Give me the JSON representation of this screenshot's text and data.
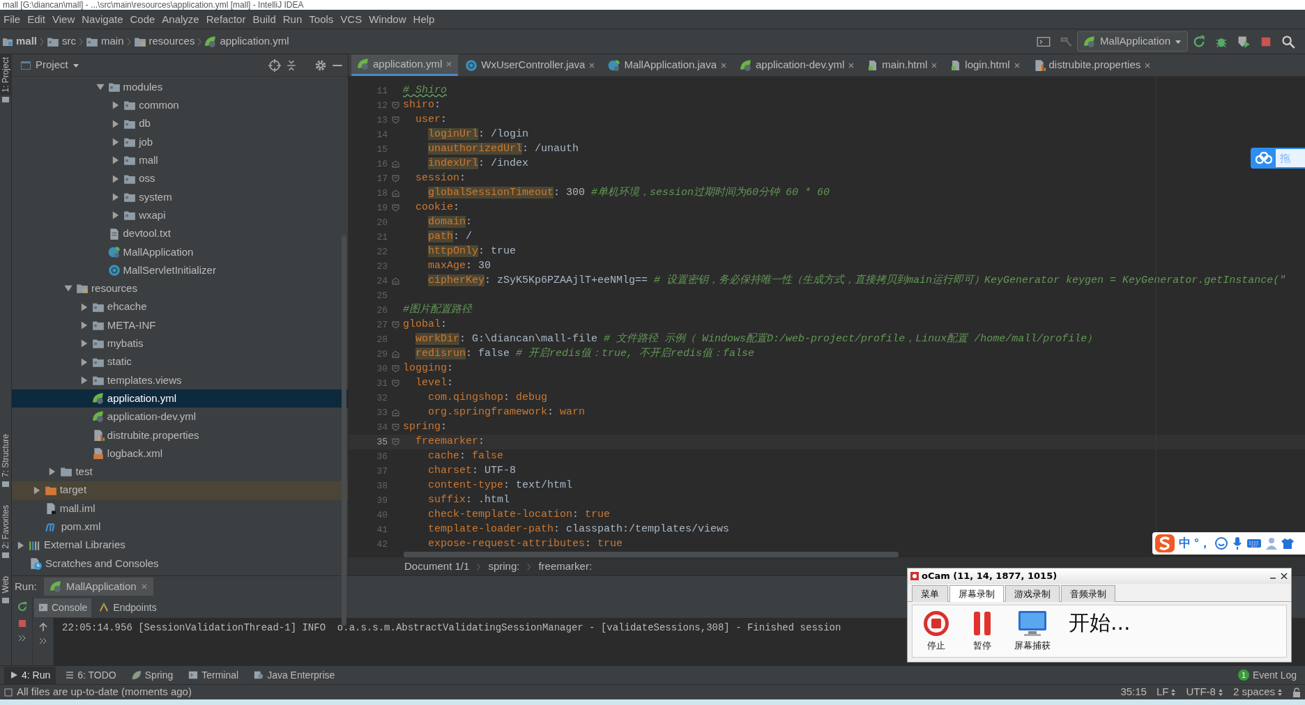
{
  "title_bar": {
    "title": "mall [G:\\diancan\\mall] - ...\\src\\main\\resources\\application.yml [mall] - IntelliJ IDEA"
  },
  "menu": [
    "File",
    "Edit",
    "View",
    "Navigate",
    "Code",
    "Analyze",
    "Refactor",
    "Build",
    "Run",
    "Tools",
    "VCS",
    "Window",
    "Help"
  ],
  "breadcrumbs": [
    {
      "label": "mall",
      "kind": "module"
    },
    {
      "label": "src",
      "kind": "folder"
    },
    {
      "label": "main",
      "kind": "folder"
    },
    {
      "label": "resources",
      "kind": "resources-folder"
    },
    {
      "label": "application.yml",
      "kind": "yaml"
    }
  ],
  "run_config": {
    "label": "MallApplication"
  },
  "side_tabs": [
    {
      "label": "1: Project",
      "selected": true
    },
    {
      "label": "7: Structure",
      "selected": false
    },
    {
      "label": "2: Favorites",
      "selected": false
    },
    {
      "label": "Web",
      "selected": false
    }
  ],
  "project_panel": {
    "title": "Project",
    "tree": [
      {
        "children": [
          {
            "children": [
              {
                "children": [
                  {
                    "children": [
                      {
                        "children": [
                          {
                            "label": "modules",
                            "kind": "folder",
                            "expanded": true,
                            "selected": false,
                            "children": [
                              {
                                "label": "common",
                                "kind": "folder",
                                "expanded": false,
                                "selected": false
                              },
                              {
                                "label": "db",
                                "kind": "folder",
                                "expanded": false,
                                "selected": false
                              },
                              {
                                "label": "job",
                                "kind": "folder",
                                "expanded": false,
                                "selected": false
                              },
                              {
                                "label": "mall",
                                "kind": "folder",
                                "expanded": false,
                                "selected": false
                              },
                              {
                                "label": "oss",
                                "kind": "folder",
                                "expanded": false,
                                "selected": false
                              },
                              {
                                "label": "system",
                                "kind": "folder",
                                "expanded": false,
                                "selected": false
                              },
                              {
                                "label": "wxapi",
                                "kind": "folder",
                                "expanded": false,
                                "selected": false
                              }
                            ]
                          },
                          {
                            "label": "devtool.txt",
                            "kind": "text",
                            "selected": false
                          },
                          {
                            "label": "MallApplication",
                            "kind": "spring-class",
                            "selected": false
                          },
                          {
                            "label": "MallServletInitializer",
                            "kind": "class",
                            "selected": false
                          }
                        ]
                      }
                    ]
                  },
                  {
                    "label": "resources",
                    "kind": "resources-folder",
                    "expanded": true,
                    "selected": false,
                    "children": [
                      {
                        "label": "ehcache",
                        "kind": "folder",
                        "expanded": false,
                        "selected": false
                      },
                      {
                        "label": "META-INF",
                        "kind": "folder",
                        "expanded": false,
                        "selected": false
                      },
                      {
                        "label": "mybatis",
                        "kind": "folder",
                        "expanded": false,
                        "selected": false
                      },
                      {
                        "label": "static",
                        "kind": "folder",
                        "expanded": false,
                        "selected": false
                      },
                      {
                        "label": "templates.views",
                        "kind": "folder",
                        "expanded": false,
                        "selected": false
                      },
                      {
                        "label": "application.yml",
                        "kind": "yaml",
                        "selected": true
                      },
                      {
                        "label": "application-dev.yml",
                        "kind": "yaml",
                        "selected": false
                      },
                      {
                        "label": "distrubite.properties",
                        "kind": "properties",
                        "selected": false
                      },
                      {
                        "label": "logback.xml",
                        "kind": "xml",
                        "selected": false
                      }
                    ]
                  }
                ]
              },
              {
                "label": "test",
                "kind": "plain-folder",
                "expanded": false,
                "selected": false
              }
            ]
          },
          {
            "label": "target",
            "kind": "excluded-folder",
            "expanded": false,
            "selected": false
          },
          {
            "label": "mall.iml",
            "kind": "iml",
            "selected": false
          },
          {
            "label": "pom.xml",
            "kind": "maven",
            "selected": false
          }
        ]
      },
      {
        "label": "External Libraries",
        "kind": "libraries",
        "expanded": false,
        "selected": false
      },
      {
        "label": "Scratches and Consoles",
        "kind": "scratches",
        "selected": false
      }
    ]
  },
  "editor_tabs": [
    {
      "label": "application.yml",
      "kind": "yaml",
      "selected": true
    },
    {
      "label": "WxUserController.java",
      "kind": "class",
      "selected": false
    },
    {
      "label": "MallApplication.java",
      "kind": "spring-class",
      "selected": false
    },
    {
      "label": "application-dev.yml",
      "kind": "yaml",
      "selected": false
    },
    {
      "label": "main.html",
      "kind": "html",
      "selected": false
    },
    {
      "label": "login.html",
      "kind": "html",
      "selected": false
    },
    {
      "label": "distrubite.properties",
      "kind": "properties",
      "selected": false
    }
  ],
  "code_lines": [
    {
      "number": "11",
      "fold_start": false,
      "fold_end": false,
      "current": false,
      "segments": [
        {
          "kind": "comment-typo",
          "text": "# Shiro"
        }
      ]
    },
    {
      "number": "12",
      "fold_start": true,
      "fold_end": false,
      "current": false,
      "segments": [
        {
          "kind": "key",
          "text": "shiro"
        },
        {
          "kind": "text",
          "text": ":"
        }
      ]
    },
    {
      "number": "13",
      "fold_start": true,
      "fold_end": false,
      "current": false,
      "segments": [
        {
          "kind": "key",
          "text": "  user"
        },
        {
          "kind": "text",
          "text": ":"
        }
      ]
    },
    {
      "number": "14",
      "fold_start": false,
      "fold_end": false,
      "current": false,
      "segments": [
        {
          "kind": "key-hl",
          "text": "    loginUrl"
        },
        {
          "kind": "text",
          "text": ": /login"
        }
      ]
    },
    {
      "number": "15",
      "fold_start": false,
      "fold_end": false,
      "current": false,
      "segments": [
        {
          "kind": "key-hl",
          "text": "    unauthorizedUrl"
        },
        {
          "kind": "text",
          "text": ": /unauth"
        }
      ]
    },
    {
      "number": "16",
      "fold_start": false,
      "fold_end": true,
      "current": false,
      "segments": [
        {
          "kind": "key-hl",
          "text": "    indexUrl"
        },
        {
          "kind": "text",
          "text": ": /index"
        }
      ]
    },
    {
      "number": "17",
      "fold_start": true,
      "fold_end": false,
      "current": false,
      "segments": [
        {
          "kind": "key",
          "text": "  session"
        },
        {
          "kind": "text",
          "text": ":"
        }
      ]
    },
    {
      "number": "18",
      "fold_start": false,
      "fold_end": true,
      "current": false,
      "segments": [
        {
          "kind": "key-hl",
          "text": "    globalSessionTimeout"
        },
        {
          "kind": "text",
          "text": ": 300 "
        },
        {
          "kind": "comment",
          "text": "#单机环境，session过期时间为60分钟 60 * 60"
        }
      ]
    },
    {
      "number": "19",
      "fold_start": true,
      "fold_end": false,
      "current": false,
      "segments": [
        {
          "kind": "key",
          "text": "  cookie"
        },
        {
          "kind": "text",
          "text": ":"
        }
      ]
    },
    {
      "number": "20",
      "fold_start": false,
      "fold_end": false,
      "current": false,
      "segments": [
        {
          "kind": "key-hl",
          "text": "    domain"
        },
        {
          "kind": "text",
          "text": ":"
        }
      ]
    },
    {
      "number": "21",
      "fold_start": false,
      "fold_end": false,
      "current": false,
      "segments": [
        {
          "kind": "key-hl",
          "text": "    path"
        },
        {
          "kind": "text",
          "text": ": /"
        }
      ]
    },
    {
      "number": "22",
      "fold_start": false,
      "fold_end": false,
      "current": false,
      "segments": [
        {
          "kind": "key-hl",
          "text": "    httpOnly"
        },
        {
          "kind": "text",
          "text": ": true"
        }
      ]
    },
    {
      "number": "23",
      "fold_start": false,
      "fold_end": false,
      "current": false,
      "segments": [
        {
          "kind": "key",
          "text": "    maxAge"
        },
        {
          "kind": "text",
          "text": ": 30"
        }
      ]
    },
    {
      "number": "24",
      "fold_start": false,
      "fold_end": true,
      "current": false,
      "segments": [
        {
          "kind": "key-hl",
          "text": "    cipherKey"
        },
        {
          "kind": "text",
          "text": ": zSyK5Kp6PZAAjlT+eeNMlg== "
        },
        {
          "kind": "comment",
          "text": "# 设置密钥，务必保持唯一性（生成方式，直接拷贝到main运行即可）KeyGenerator keygen = KeyGenerator.getInstance(\""
        }
      ]
    },
    {
      "number": "25",
      "fold_start": false,
      "fold_end": false,
      "current": false
    },
    {
      "number": "26",
      "fold_start": false,
      "fold_end": false,
      "current": false,
      "segments": [
        {
          "kind": "comment",
          "text": "#图片配置路径"
        }
      ]
    },
    {
      "number": "27",
      "fold_start": true,
      "fold_end": false,
      "current": false,
      "segments": [
        {
          "kind": "key",
          "text": "global"
        },
        {
          "kind": "text",
          "text": ":"
        }
      ]
    },
    {
      "number": "28",
      "fold_start": false,
      "fold_end": false,
      "current": false,
      "segments": [
        {
          "kind": "key-hl",
          "text": "  workDir"
        },
        {
          "kind": "text",
          "text": ": G:\\diancan\\mall-file "
        },
        {
          "kind": "comment",
          "text": "# 文件路径 示例（ Windows配置D:/web-project/profile，Linux配置 /home/mall/profile）"
        }
      ]
    },
    {
      "number": "29",
      "fold_start": false,
      "fold_end": true,
      "current": false,
      "segments": [
        {
          "kind": "key-hl",
          "text": "  redisrun"
        },
        {
          "kind": "text",
          "text": ": false "
        },
        {
          "kind": "comment",
          "text": "# 开启redis值：true, 不开启redis值：false"
        }
      ]
    },
    {
      "number": "30",
      "fold_start": true,
      "fold_end": false,
      "current": false,
      "segments": [
        {
          "kind": "key",
          "text": "logging"
        },
        {
          "kind": "text",
          "text": ":"
        }
      ]
    },
    {
      "number": "31",
      "fold_start": true,
      "fold_end": false,
      "current": false,
      "segments": [
        {
          "kind": "key",
          "text": "  level"
        },
        {
          "kind": "text",
          "text": ":"
        }
      ]
    },
    {
      "number": "32",
      "fold_start": false,
      "fold_end": false,
      "current": false,
      "segments": [
        {
          "kind": "key",
          "text": "    com.qingshop"
        },
        {
          "kind": "text",
          "text": ": "
        },
        {
          "kind": "keyword",
          "text": "debug"
        }
      ]
    },
    {
      "number": "33",
      "fold_start": false,
      "fold_end": true,
      "current": false,
      "segments": [
        {
          "kind": "key",
          "text": "    org.springframework"
        },
        {
          "kind": "text",
          "text": ": "
        },
        {
          "kind": "keyword",
          "text": "warn"
        }
      ]
    },
    {
      "number": "34",
      "fold_start": true,
      "fold_end": false,
      "current": false,
      "segments": [
        {
          "kind": "key",
          "text": "spring"
        },
        {
          "kind": "text",
          "text": ":"
        }
      ]
    },
    {
      "number": "35",
      "fold_start": true,
      "fold_end": false,
      "current": true,
      "segments": [
        {
          "kind": "key",
          "text": "  freemarker"
        },
        {
          "kind": "text",
          "text": ":"
        }
      ]
    },
    {
      "number": "36",
      "fold_start": false,
      "fold_end": false,
      "current": false,
      "segments": [
        {
          "kind": "key",
          "text": "    cache"
        },
        {
          "kind": "text",
          "text": ": "
        },
        {
          "kind": "keyword",
          "text": "false"
        }
      ]
    },
    {
      "number": "37",
      "fold_start": false,
      "fold_end": false,
      "current": false,
      "segments": [
        {
          "kind": "key",
          "text": "    charset"
        },
        {
          "kind": "text",
          "text": ": UTF-8"
        }
      ]
    },
    {
      "number": "38",
      "fold_start": false,
      "fold_end": false,
      "current": false,
      "segments": [
        {
          "kind": "key",
          "text": "    content-type"
        },
        {
          "kind": "text",
          "text": ": text/html"
        }
      ]
    },
    {
      "number": "39",
      "fold_start": false,
      "fold_end": false,
      "current": false,
      "segments": [
        {
          "kind": "key",
          "text": "    suffix"
        },
        {
          "kind": "text",
          "text": ": .html"
        }
      ]
    },
    {
      "number": "40",
      "fold_start": false,
      "fold_end": false,
      "current": false,
      "segments": [
        {
          "kind": "key",
          "text": "    check-template-location"
        },
        {
          "kind": "text",
          "text": ": "
        },
        {
          "kind": "keyword",
          "text": "true"
        }
      ]
    },
    {
      "number": "41",
      "fold_start": false,
      "fold_end": false,
      "current": false,
      "segments": [
        {
          "kind": "key",
          "text": "    template-loader-path"
        },
        {
          "kind": "text",
          "text": ": classpath:/templates/views"
        }
      ]
    },
    {
      "number": "42",
      "fold_start": false,
      "fold_end": false,
      "current": false,
      "segments": [
        {
          "kind": "key",
          "text": "    expose-request-attributes"
        },
        {
          "kind": "text",
          "text": ": "
        },
        {
          "kind": "keyword",
          "text": "true"
        }
      ]
    }
  ],
  "editor_breadcrumbs": [
    "Document 1/1",
    "spring:",
    "freemarker:"
  ],
  "run_panel": {
    "label": "Run:",
    "config": "MallApplication",
    "tabs": [
      {
        "label": "Console",
        "kind": "console",
        "selected": true
      },
      {
        "label": "Endpoints",
        "kind": "endpoints",
        "selected": false
      }
    ],
    "log_lines": [
      "22:05:14.956 [SessionValidationThread-1] INFO  o.a.s.s.m.AbstractValidatingSessionManager - [validateSessions,308] - Finished session"
    ]
  },
  "tool_tabs": [
    {
      "label": "4: Run",
      "kind": "run",
      "selected": true
    },
    {
      "label": "6: TODO",
      "kind": "todo",
      "selected": false
    },
    {
      "label": "Spring",
      "kind": "spring",
      "selected": false
    },
    {
      "label": "Terminal",
      "kind": "terminal",
      "selected": false
    },
    {
      "label": "Java Enterprise",
      "kind": "java-ee",
      "selected": false
    }
  ],
  "event_log": {
    "label": "Event Log",
    "count": "1"
  },
  "status_bar": {
    "message": "All files are up-to-date (moments ago)",
    "position": "35:15",
    "line_separator": "LF",
    "encoding": "UTF-8",
    "indent": "2 spaces"
  },
  "cloud_widget": {
    "label": "拖"
  },
  "ime_toolbar": {
    "items": [
      "中",
      "°，"
    ]
  },
  "ocam": {
    "title": "oCam (11, 14, 1877, 1015)",
    "tabs": [
      {
        "label": "菜单",
        "selected": false
      },
      {
        "label": "屏幕录制",
        "selected": true
      },
      {
        "label": "游戏录制",
        "selected": false
      },
      {
        "label": "音频录制",
        "selected": false
      }
    ],
    "buttons": [
      {
        "label": "停止",
        "kind": "stop"
      },
      {
        "label": "暂停",
        "kind": "pause"
      },
      {
        "label": "屏幕捕获",
        "kind": "capture"
      }
    ],
    "status": "开始..."
  }
}
